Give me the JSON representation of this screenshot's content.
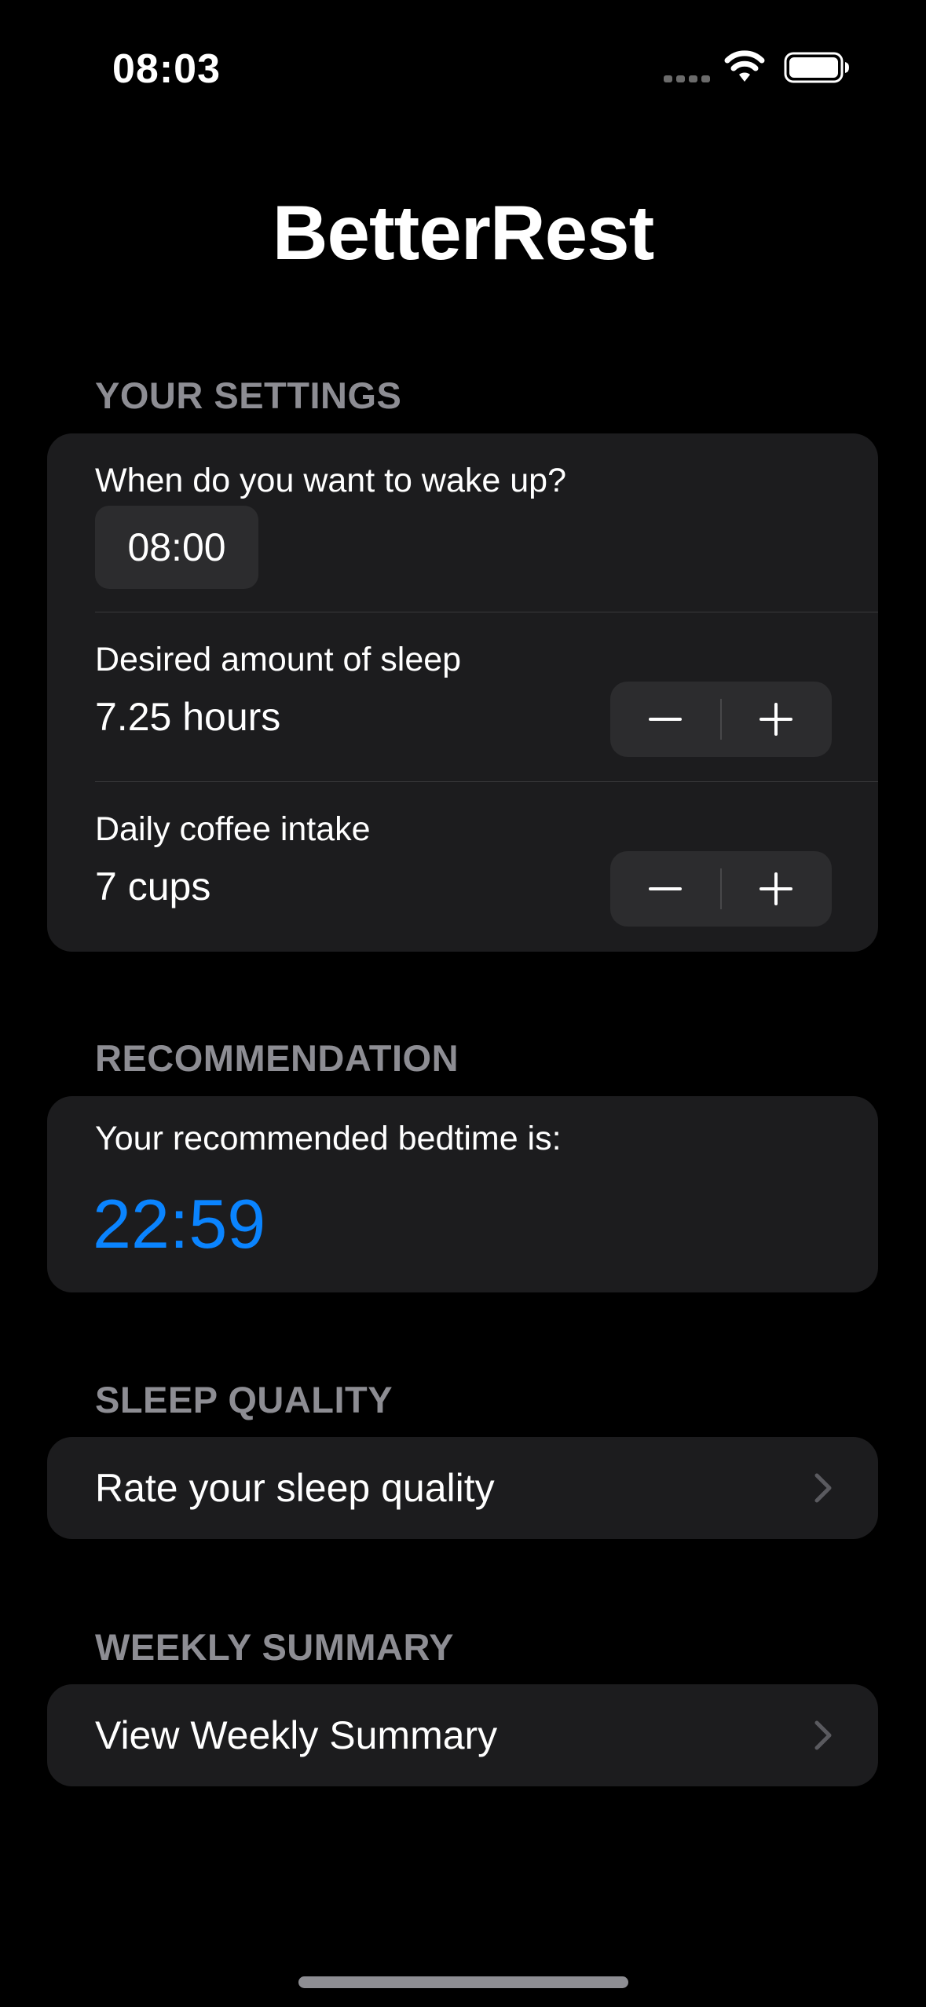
{
  "status_bar": {
    "time": "08:03",
    "icons": [
      "cellular-signal-icon",
      "wifi-icon",
      "battery-icon"
    ]
  },
  "app": {
    "title": "BetterRest"
  },
  "settings": {
    "header": "YOUR SETTINGS",
    "wake_up": {
      "label": "When do you want to wake up?",
      "value": "08:00"
    },
    "sleep_amount": {
      "label": "Desired amount of sleep",
      "value": "7.25 hours",
      "decrement_icon": "minus-icon",
      "increment_icon": "plus-icon"
    },
    "coffee": {
      "label": "Daily coffee intake",
      "value": "7 cups",
      "decrement_icon": "minus-icon",
      "increment_icon": "plus-icon"
    }
  },
  "recommendation": {
    "header": "RECOMMENDATION",
    "label": "Your recommended bedtime is:",
    "bedtime": "22:59"
  },
  "sleep_quality": {
    "header": "SLEEP QUALITY",
    "link_label": "Rate your sleep quality",
    "icon": "chevron-right-icon"
  },
  "weekly_summary": {
    "header": "WEEKLY SUMMARY",
    "link_label": "View Weekly Summary",
    "icon": "chevron-right-icon"
  },
  "colors": {
    "background": "#000000",
    "card": "#1c1c1e",
    "control": "#2c2c2e",
    "section_header": "#8d8d93",
    "accent": "#0a84ff",
    "chevron": "#5a5a5f"
  }
}
